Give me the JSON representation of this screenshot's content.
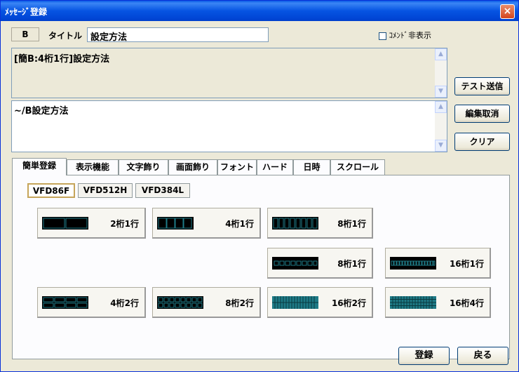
{
  "window": {
    "title": "ﾒｯｾｰｼﾞ登録",
    "close_label": "×"
  },
  "header": {
    "code": "B",
    "title_label": "タイトル",
    "title_value": "設定方法",
    "hide_comment_label": "ｺﾒﾝﾄﾞ非表示"
  },
  "text1": "[簡B:4桁1行]設定方法",
  "text2": "~/B設定方法",
  "side_buttons": {
    "test": "テスト送信",
    "cancel": "編集取消",
    "clear": "クリア"
  },
  "tabs": [
    "簡単登録",
    "表示機能",
    "文字飾り",
    "画面飾り",
    "フォント",
    "ハード",
    "日時",
    "スクロール"
  ],
  "subtabs": [
    "VFD86F",
    "VFD512H",
    "VFD384L"
  ],
  "layouts": [
    {
      "label": "2桁1行"
    },
    {
      "label": "4桁1行"
    },
    {
      "label": "8桁1行"
    },
    {
      "label": "8桁1行"
    },
    {
      "label": "16桁1行"
    },
    {
      "label": "4桁2行"
    },
    {
      "label": "8桁2行"
    },
    {
      "label": "16桁2行"
    },
    {
      "label": "16桁4行"
    }
  ],
  "footer": {
    "register": "登録",
    "back": "戻る"
  },
  "colors": {
    "segment_fill": "#000000",
    "segment_cell": "#1e7a86"
  }
}
